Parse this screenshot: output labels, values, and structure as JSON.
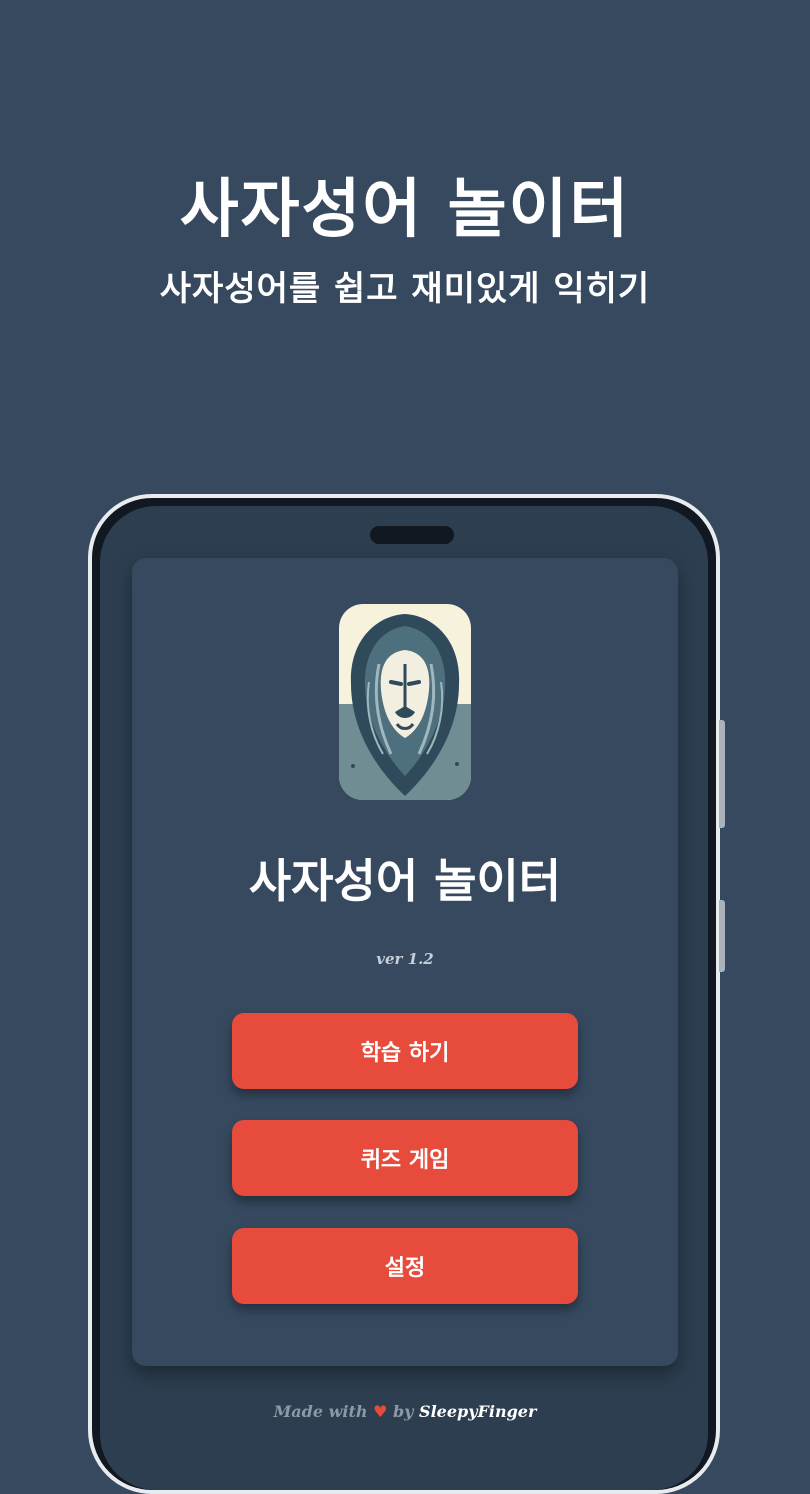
{
  "hero": {
    "title": "사자성어 놀이터",
    "subtitle": "사자성어를 쉽고 재미있게 익히기"
  },
  "app": {
    "title": "사자성어 놀이터",
    "version": "ver 1.2",
    "logo_icon": "lion-icon"
  },
  "menu": {
    "items": [
      {
        "label": "학습 하기"
      },
      {
        "label": "퀴즈 게임"
      },
      {
        "label": "설정"
      }
    ]
  },
  "footer": {
    "made_with": "Made with",
    "heart": "♥",
    "by": "by",
    "author": "SleepyFinger"
  },
  "colors": {
    "background": "#36495f",
    "button": "#e64b3c",
    "phone_screen": "#2c3e50"
  }
}
